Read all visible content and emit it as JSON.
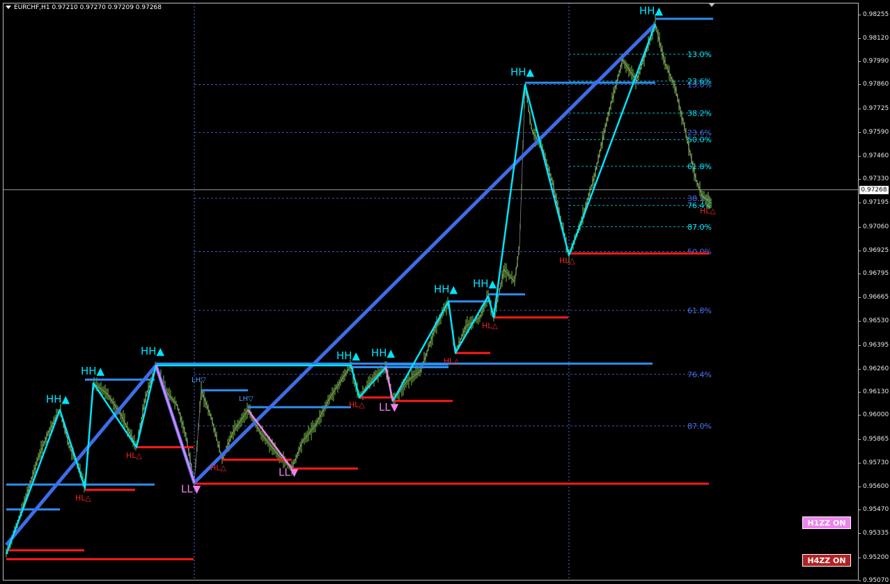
{
  "header": {
    "symbol": "EURCHF,H1",
    "ohlc": "0.97210 0.97270 0.97209 0.97268"
  },
  "current_price": "0.97268",
  "buttons": {
    "h1zz": "H1ZZ ON",
    "h4zz": "H4ZZ ON"
  },
  "colors": {
    "background": "#000000",
    "candle": "#7cc242",
    "h1_zigzag": "#00e5ff",
    "h1_down_leg": "#ee82ee",
    "h4_zigzag": "#3d6ee8",
    "resistance": "#2e8ef0",
    "support": "#ff1a1a",
    "fib_h1": "#00e5ff",
    "fib_h4": "#4d6ee8",
    "hh_label": "#00e5ff",
    "hl_label": "#ff2020",
    "ll_label": "#ee82ee",
    "lh_label": "#4d9eff"
  },
  "chart_data": {
    "type": "line",
    "symbol": "EURCHF",
    "timeframe": "H1",
    "ylim": [
      0.9507,
      0.9832
    ],
    "xlim": [
      0,
      1229
    ],
    "y_ticks": [
      0.98255,
      0.9812,
      0.9799,
      0.9786,
      0.97725,
      0.9759,
      0.9746,
      0.9733,
      0.97195,
      0.9706,
      0.96925,
      0.96795,
      0.96665,
      0.9653,
      0.96395,
      0.9626,
      0.9613,
      0.96,
      0.95865,
      0.9573,
      0.956,
      0.9547,
      0.95335,
      0.952,
      0.9507
    ],
    "y_tick_labels": [
      "0.98255",
      "0.98120",
      "0.97990",
      "0.97860",
      "0.97725",
      "0.97590",
      "0.97460",
      "0.97330",
      "0.97195",
      "0.97060",
      "0.96925",
      "0.96795",
      "0.96665",
      "0.96530",
      "0.96395",
      "0.96260",
      "0.96130",
      "0.96000",
      "0.95865",
      "0.95730",
      "0.95600",
      "0.95470",
      "0.95335",
      "0.95200",
      "0.95070"
    ],
    "vertical_grid_x": [
      275,
      813
    ],
    "price_path": [
      [
        5,
        0.9522
      ],
      [
        20,
        0.9538
      ],
      [
        35,
        0.9556
      ],
      [
        50,
        0.9575
      ],
      [
        65,
        0.959
      ],
      [
        82,
        0.9603
      ],
      [
        95,
        0.9583
      ],
      [
        110,
        0.957
      ],
      [
        118,
        0.9559
      ],
      [
        130,
        0.9618
      ],
      [
        150,
        0.9612
      ],
      [
        170,
        0.96
      ],
      [
        192,
        0.9582
      ],
      [
        205,
        0.961
      ],
      [
        220,
        0.9628
      ],
      [
        235,
        0.9613
      ],
      [
        250,
        0.9606
      ],
      [
        262,
        0.959
      ],
      [
        275,
        0.9562
      ],
      [
        285,
        0.9614
      ],
      [
        300,
        0.9598
      ],
      [
        315,
        0.9575
      ],
      [
        330,
        0.959
      ],
      [
        352,
        0.9603
      ],
      [
        370,
        0.959
      ],
      [
        395,
        0.9578
      ],
      [
        415,
        0.957
      ],
      [
        430,
        0.9585
      ],
      [
        450,
        0.9595
      ],
      [
        470,
        0.961
      ],
      [
        500,
        0.9628
      ],
      [
        512,
        0.961
      ],
      [
        530,
        0.962
      ],
      [
        550,
        0.9627
      ],
      [
        560,
        0.9608
      ],
      [
        580,
        0.9619
      ],
      [
        600,
        0.9625
      ],
      [
        620,
        0.9648
      ],
      [
        640,
        0.9664
      ],
      [
        650,
        0.9635
      ],
      [
        665,
        0.965
      ],
      [
        685,
        0.9655
      ],
      [
        697,
        0.9667
      ],
      [
        705,
        0.9655
      ],
      [
        720,
        0.9682
      ],
      [
        735,
        0.9675
      ],
      [
        742,
        0.9695
      ],
      [
        750,
        0.9786
      ],
      [
        760,
        0.976
      ],
      [
        775,
        0.975
      ],
      [
        790,
        0.973
      ],
      [
        800,
        0.9712
      ],
      [
        813,
        0.969
      ],
      [
        830,
        0.9708
      ],
      [
        850,
        0.9735
      ],
      [
        870,
        0.977
      ],
      [
        890,
        0.98
      ],
      [
        910,
        0.9788
      ],
      [
        937,
        0.982
      ],
      [
        950,
        0.9799
      ],
      [
        965,
        0.9785
      ],
      [
        980,
        0.976
      ],
      [
        995,
        0.9733
      ],
      [
        1005,
        0.9723
      ],
      [
        1018,
        0.9719
      ]
    ],
    "h1_zigzag": [
      [
        5,
        0.9522
      ],
      [
        82,
        0.9603
      ],
      [
        118,
        0.9559
      ],
      [
        130,
        0.9618
      ],
      [
        192,
        0.9582
      ],
      [
        220,
        0.9628
      ],
      [
        500,
        0.9628
      ],
      [
        512,
        0.961
      ],
      [
        550,
        0.9627
      ],
      [
        560,
        0.9608
      ],
      [
        640,
        0.9664
      ],
      [
        650,
        0.9635
      ],
      [
        697,
        0.9667
      ],
      [
        705,
        0.9655
      ],
      [
        750,
        0.9786
      ],
      [
        813,
        0.969
      ],
      [
        937,
        0.982
      ]
    ],
    "h1_down_legs": [
      [
        [
          220,
          0.9628
        ],
        [
          275,
          0.9562
        ]
      ],
      [
        [
          352,
          0.9603
        ],
        [
          415,
          0.957
        ]
      ],
      [
        [
          550,
          0.9627
        ],
        [
          560,
          0.9608
        ]
      ]
    ],
    "h4_zigzag": [
      [
        5,
        0.9527
      ],
      [
        220,
        0.9628
      ],
      [
        275,
        0.9562
      ],
      [
        937,
        0.982
      ]
    ],
    "resistance_levels": [
      {
        "x1": 5,
        "x2": 82,
        "y": 0.9547
      },
      {
        "x1": 5,
        "x2": 218,
        "y": 0.9561
      },
      {
        "x1": 118,
        "x2": 218,
        "y": 0.962
      },
      {
        "x1": 220,
        "x2": 933,
        "y": 0.9629
      },
      {
        "x1": 285,
        "x2": 352,
        "y": 0.9614
      },
      {
        "x1": 352,
        "x2": 500,
        "y": 0.96045
      },
      {
        "x1": 500,
        "x2": 640,
        "y": 0.9627
      },
      {
        "x1": 550,
        "x2": 640,
        "y": 0.96285
      },
      {
        "x1": 640,
        "x2": 697,
        "y": 0.9664
      },
      {
        "x1": 697,
        "x2": 750,
        "y": 0.9668
      },
      {
        "x1": 750,
        "x2": 937,
        "y": 0.9787
      },
      {
        "x1": 937,
        "x2": 1020,
        "y": 0.9823
      }
    ],
    "support_levels": [
      {
        "x1": 5,
        "x2": 117,
        "y": 0.9524
      },
      {
        "x1": 5,
        "x2": 274,
        "y": 0.9519
      },
      {
        "x1": 118,
        "x2": 190,
        "y": 0.9558
      },
      {
        "x1": 192,
        "x2": 274,
        "y": 0.9582
      },
      {
        "x1": 275,
        "x2": 1014,
        "y": 0.95615
      },
      {
        "x1": 315,
        "x2": 415,
        "y": 0.9575
      },
      {
        "x1": 415,
        "x2": 510,
        "y": 0.957
      },
      {
        "x1": 512,
        "x2": 560,
        "y": 0.961
      },
      {
        "x1": 560,
        "x2": 646,
        "y": 0.9608
      },
      {
        "x1": 650,
        "x2": 700,
        "y": 0.9635
      },
      {
        "x1": 705,
        "x2": 812,
        "y": 0.9655
      },
      {
        "x1": 813,
        "x2": 1014,
        "y": 0.9691
      }
    ],
    "fib_h1": {
      "x1": 813,
      "x2": 1018,
      "levels": [
        {
          "label": "13.0%",
          "y": 0.9803
        },
        {
          "label": "23.6%",
          "y": 0.9788
        },
        {
          "label": "38.2%",
          "y": 0.977
        },
        {
          "label": "50.0%",
          "y": 0.9755
        },
        {
          "label": "61.8%",
          "y": 0.974
        },
        {
          "label": "76.4%",
          "y": 0.9718
        },
        {
          "label": "87.0%",
          "y": 0.9706
        }
      ]
    },
    "fib_h4": {
      "x1": 275,
      "x2": 1018,
      "levels": [
        {
          "label": "13.0%",
          "y": 0.9786
        },
        {
          "label": "23.6%",
          "y": 0.9759
        },
        {
          "label": "38.2%",
          "y": 0.9722
        },
        {
          "label": "50.0%",
          "y": 0.9692
        },
        {
          "label": "61.8%",
          "y": 0.9659
        },
        {
          "label": "76.4%",
          "y": 0.9623
        },
        {
          "label": "87.0%",
          "y": 0.9594
        }
      ]
    },
    "swing_labels": [
      {
        "text": "HH▲",
        "x": 62,
        "y": 0.9607,
        "kind": "hh"
      },
      {
        "text": "HH▲",
        "x": 112,
        "y": 0.9623,
        "kind": "hh"
      },
      {
        "text": "HH▲",
        "x": 198,
        "y": 0.9634,
        "kind": "hh"
      },
      {
        "text": "HH▲",
        "x": 479,
        "y": 0.96315,
        "kind": "hh"
      },
      {
        "text": "HH▲",
        "x": 529,
        "y": 0.9633,
        "kind": "hh"
      },
      {
        "text": "HH▲",
        "x": 619,
        "y": 0.9669,
        "kind": "hh"
      },
      {
        "text": "HH▲",
        "x": 675,
        "y": 0.9672,
        "kind": "hh"
      },
      {
        "text": "HH▲",
        "x": 729,
        "y": 0.9791,
        "kind": "hh"
      },
      {
        "text": "HH▲",
        "x": 914,
        "y": 0.98255,
        "kind": "hh"
      },
      {
        "text": "HL△",
        "x": 104,
        "y": 0.9552,
        "kind": "hl"
      },
      {
        "text": "HL△",
        "x": 177,
        "y": 0.9576,
        "kind": "hl"
      },
      {
        "text": "HL△",
        "x": 298,
        "y": 0.9569,
        "kind": "hl"
      },
      {
        "text": "HL△",
        "x": 497,
        "y": 0.96045,
        "kind": "hl"
      },
      {
        "text": "HL△",
        "x": 633,
        "y": 0.9629,
        "kind": "hl"
      },
      {
        "text": "HL△",
        "x": 688,
        "y": 0.9649,
        "kind": "hl"
      },
      {
        "text": "HL△",
        "x": 799,
        "y": 0.96855,
        "kind": "hl"
      },
      {
        "text": "HL△",
        "x": 1001,
        "y": 0.97135,
        "kind": "hl"
      },
      {
        "text": "LL▼",
        "x": 256,
        "y": 0.95565,
        "kind": "ll"
      },
      {
        "text": "LL▼",
        "x": 396,
        "y": 0.9566,
        "kind": "ll"
      },
      {
        "text": "LL▼",
        "x": 540,
        "y": 0.96025,
        "kind": "ll"
      },
      {
        "text": "LH▽",
        "x": 271,
        "y": 0.96185,
        "kind": "lh"
      },
      {
        "text": "LH▽",
        "x": 339,
        "y": 0.9608,
        "kind": "lh"
      }
    ]
  }
}
